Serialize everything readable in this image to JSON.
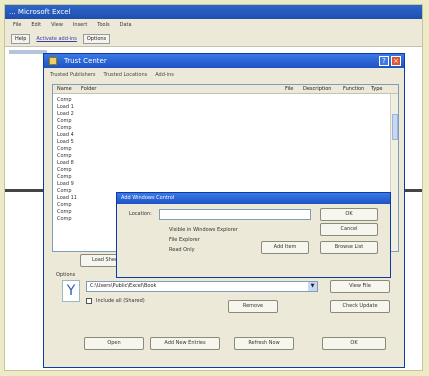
{
  "app": {
    "title": "...  Microsoft Excel",
    "menu": [
      "File",
      "Edit",
      "View",
      "Insert",
      "Tools",
      "Data"
    ],
    "toolbar": {
      "button_1": "Help",
      "link": "Activate add-ins",
      "button_2": "Options"
    }
  },
  "dialog": {
    "title": "Trust Center",
    "tabs": [
      "Trusted Publishers",
      "Trusted Locations",
      "Add-ins"
    ],
    "list": {
      "columns": [
        "Name",
        "Folder",
        "File",
        "Description",
        "Function",
        "Type"
      ],
      "rows": [
        "Comp",
        "Load 1",
        "Load 2",
        "Comp",
        "Comp",
        "Load 4",
        "Load 5",
        "Comp",
        "Comp",
        "Load 8",
        "Comp",
        "Comp",
        "Load 9",
        "Comp",
        "Load 11",
        "Comp",
        "Comp",
        "Comp"
      ]
    },
    "ctrl_icon": "Y",
    "select_value": "C:\\Users\\Public\\Excel\\Book",
    "buttons": {
      "load_more": "Load Sheet",
      "view_file": "View File",
      "ok": "Open",
      "add": "Add New Entries",
      "remove": "Remove",
      "update_list": "Check Update",
      "go": "OK",
      "new_item": "Add Item",
      "refresh": "Refresh Now"
    },
    "label_options": "Options",
    "label_checkbox": "Include all (Shared)"
  },
  "inner": {
    "title": "Add Windows Control",
    "field_label": "Location:",
    "field_value": "",
    "ok": "OK",
    "cancel": "Cancel",
    "browse": "Browse List",
    "check_1": "Visible in Windows Explorer",
    "check_2": "File Explorer",
    "check_3": "Read Only"
  }
}
